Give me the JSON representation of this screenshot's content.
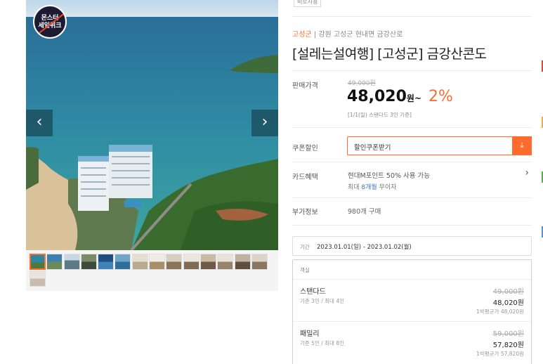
{
  "gallery": {
    "badge_line1": "몬스터",
    "badge_line2": "세일위크",
    "prev_icon": "chevron-left-icon",
    "next_icon": "chevron-right-icon",
    "thumbnail_count": 15
  },
  "product": {
    "tag": "비로사용",
    "region": "고성군",
    "location_rest": " | 강원 고성군 현내면 금강산로",
    "title": "[설레는설여행] [고성군] 금강산콘도"
  },
  "price": {
    "label": "판매가격",
    "original": "49,000원",
    "sale": "48,020",
    "sale_unit": "원~",
    "discount": "2%",
    "note": "[1/1(일) 스탠다드 3인 기준]"
  },
  "coupon": {
    "label": "쿠폰할인",
    "button_text": "할인쿠폰받기",
    "icon": "download-icon"
  },
  "card": {
    "label": "카드혜택",
    "main": "현대M포인트 50% 사용 가능",
    "sub_prefix": "최대 ",
    "sub_highlight": "8개월",
    "sub_suffix": " 무이자"
  },
  "extra": {
    "label": "부가정보",
    "value": "980개 구매"
  },
  "period": {
    "label": "기간",
    "value": "2023.01.01(일) - 2023.01.02(월)"
  },
  "rooms": {
    "header": "객실",
    "items": [
      {
        "name": "스탠다드",
        "capacity": "기준 3인 / 최대 4인",
        "original": "49,000원",
        "price": "48,020원",
        "per_night": "1박평균가 48,020원"
      },
      {
        "name": "패밀리",
        "capacity": "기준 5인 / 최대 8인",
        "original": "59,000원",
        "price": "57,820원",
        "per_night": "1박평균가 57,820원"
      }
    ]
  },
  "colors": {
    "accent": "#ff6b2c",
    "highlight_blue": "#3c6fc8",
    "edge_markers": [
      "#e8462c",
      "#f1a94b",
      "#4bb543",
      "#5a8ee0"
    ]
  }
}
